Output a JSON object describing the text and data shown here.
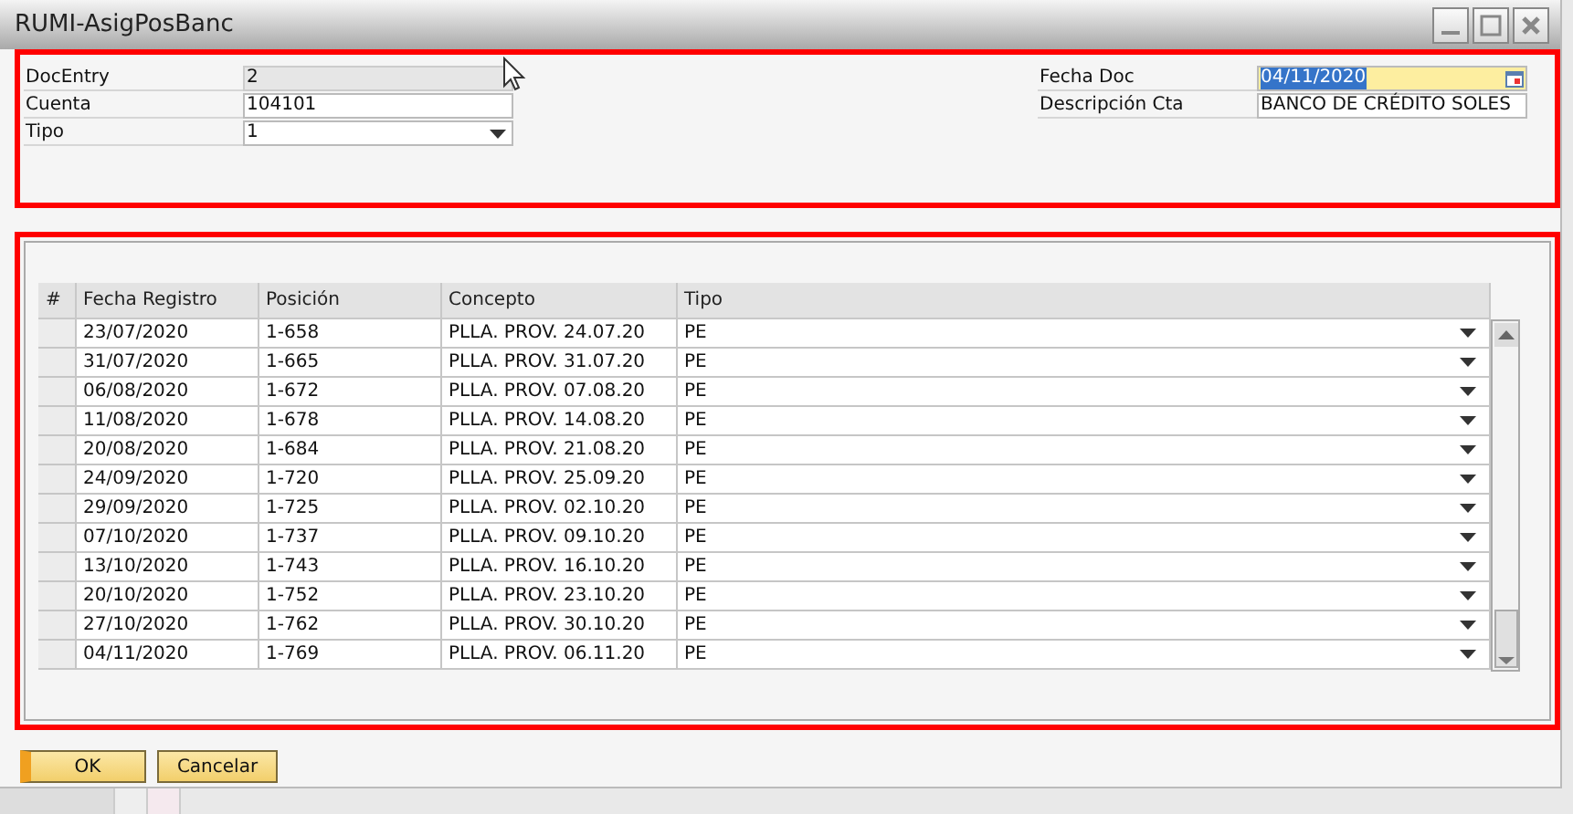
{
  "window": {
    "title": "RUMI-AsigPosBanc"
  },
  "header": {
    "left_fields": [
      {
        "label": "DocEntry",
        "value": "2",
        "kind": "readonly",
        "focused": false
      },
      {
        "label": "Cuenta",
        "value": "104101",
        "kind": "text",
        "focused": false
      },
      {
        "label": "Tipo",
        "value": "1",
        "kind": "dropdown",
        "focused": false
      }
    ],
    "right_fields": [
      {
        "label": "Fecha Doc",
        "value": "04/11/2020",
        "kind": "date",
        "focused": true
      },
      {
        "label": "Descripción Cta",
        "value": "BANCO DE CRÉDITO SOLES",
        "kind": "text",
        "focused": false
      }
    ]
  },
  "table": {
    "columns": [
      "#",
      "Fecha Registro",
      "Posición",
      "Concepto",
      "Tipo"
    ],
    "rows": [
      {
        "fecha": "23/07/2020",
        "posicion": "1-658",
        "concepto": "PLLA. PROV. 24.07.20",
        "tipo": "PE"
      },
      {
        "fecha": "31/07/2020",
        "posicion": "1-665",
        "concepto": "PLLA. PROV. 31.07.20",
        "tipo": "PE"
      },
      {
        "fecha": "06/08/2020",
        "posicion": "1-672",
        "concepto": "PLLA. PROV. 07.08.20",
        "tipo": "PE"
      },
      {
        "fecha": "11/08/2020",
        "posicion": "1-678",
        "concepto": "PLLA. PROV. 14.08.20",
        "tipo": "PE"
      },
      {
        "fecha": "20/08/2020",
        "posicion": "1-684",
        "concepto": "PLLA. PROV. 21.08.20",
        "tipo": "PE"
      },
      {
        "fecha": "24/09/2020",
        "posicion": "1-720",
        "concepto": "PLLA. PROV. 25.09.20",
        "tipo": "PE"
      },
      {
        "fecha": "29/09/2020",
        "posicion": "1-725",
        "concepto": "PLLA. PROV. 02.10.20",
        "tipo": "PE"
      },
      {
        "fecha": "07/10/2020",
        "posicion": "1-737",
        "concepto": "PLLA. PROV. 09.10.20",
        "tipo": "PE"
      },
      {
        "fecha": "13/10/2020",
        "posicion": "1-743",
        "concepto": "PLLA. PROV. 16.10.20",
        "tipo": "PE"
      },
      {
        "fecha": "20/10/2020",
        "posicion": "1-752",
        "concepto": "PLLA. PROV. 23.10.20",
        "tipo": "PE"
      },
      {
        "fecha": "27/10/2020",
        "posicion": "1-762",
        "concepto": "PLLA. PROV. 30.10.20",
        "tipo": "PE"
      },
      {
        "fecha": "04/11/2020",
        "posicion": "1-769",
        "concepto": "PLLA. PROV. 06.11.20",
        "tipo": "PE"
      }
    ]
  },
  "buttons": [
    {
      "label": "OK",
      "kind": "primary"
    },
    {
      "label": "Cancelar",
      "kind": "secondary"
    }
  ]
}
